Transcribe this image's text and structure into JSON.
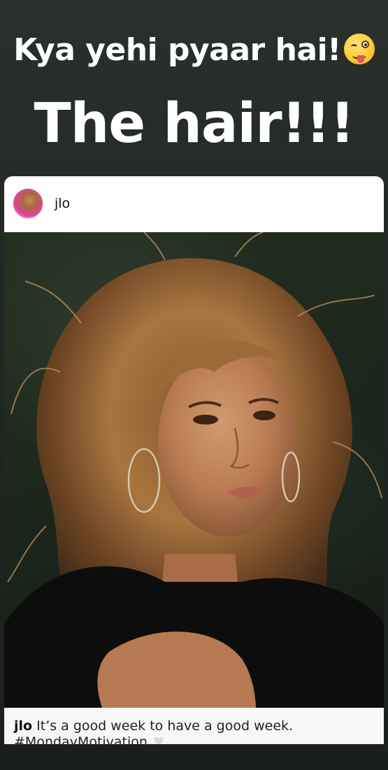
{
  "story": {
    "caption_line1": "Kya yehi pyaar hai!",
    "caption_line1_emoji": "winking-face-with-tongue",
    "caption_line2": "The hair!!!"
  },
  "post": {
    "username": "jlo",
    "caption_username": "jlo",
    "caption_text": "It’s a good week to have a good week.",
    "caption_hashtag": "#MondayMotivation",
    "photo_subject": "woman-with-curly-hair-portrait"
  },
  "colors": {
    "background": "#1f2522",
    "card": "#ffffff",
    "caption_text": "#ffffff"
  }
}
